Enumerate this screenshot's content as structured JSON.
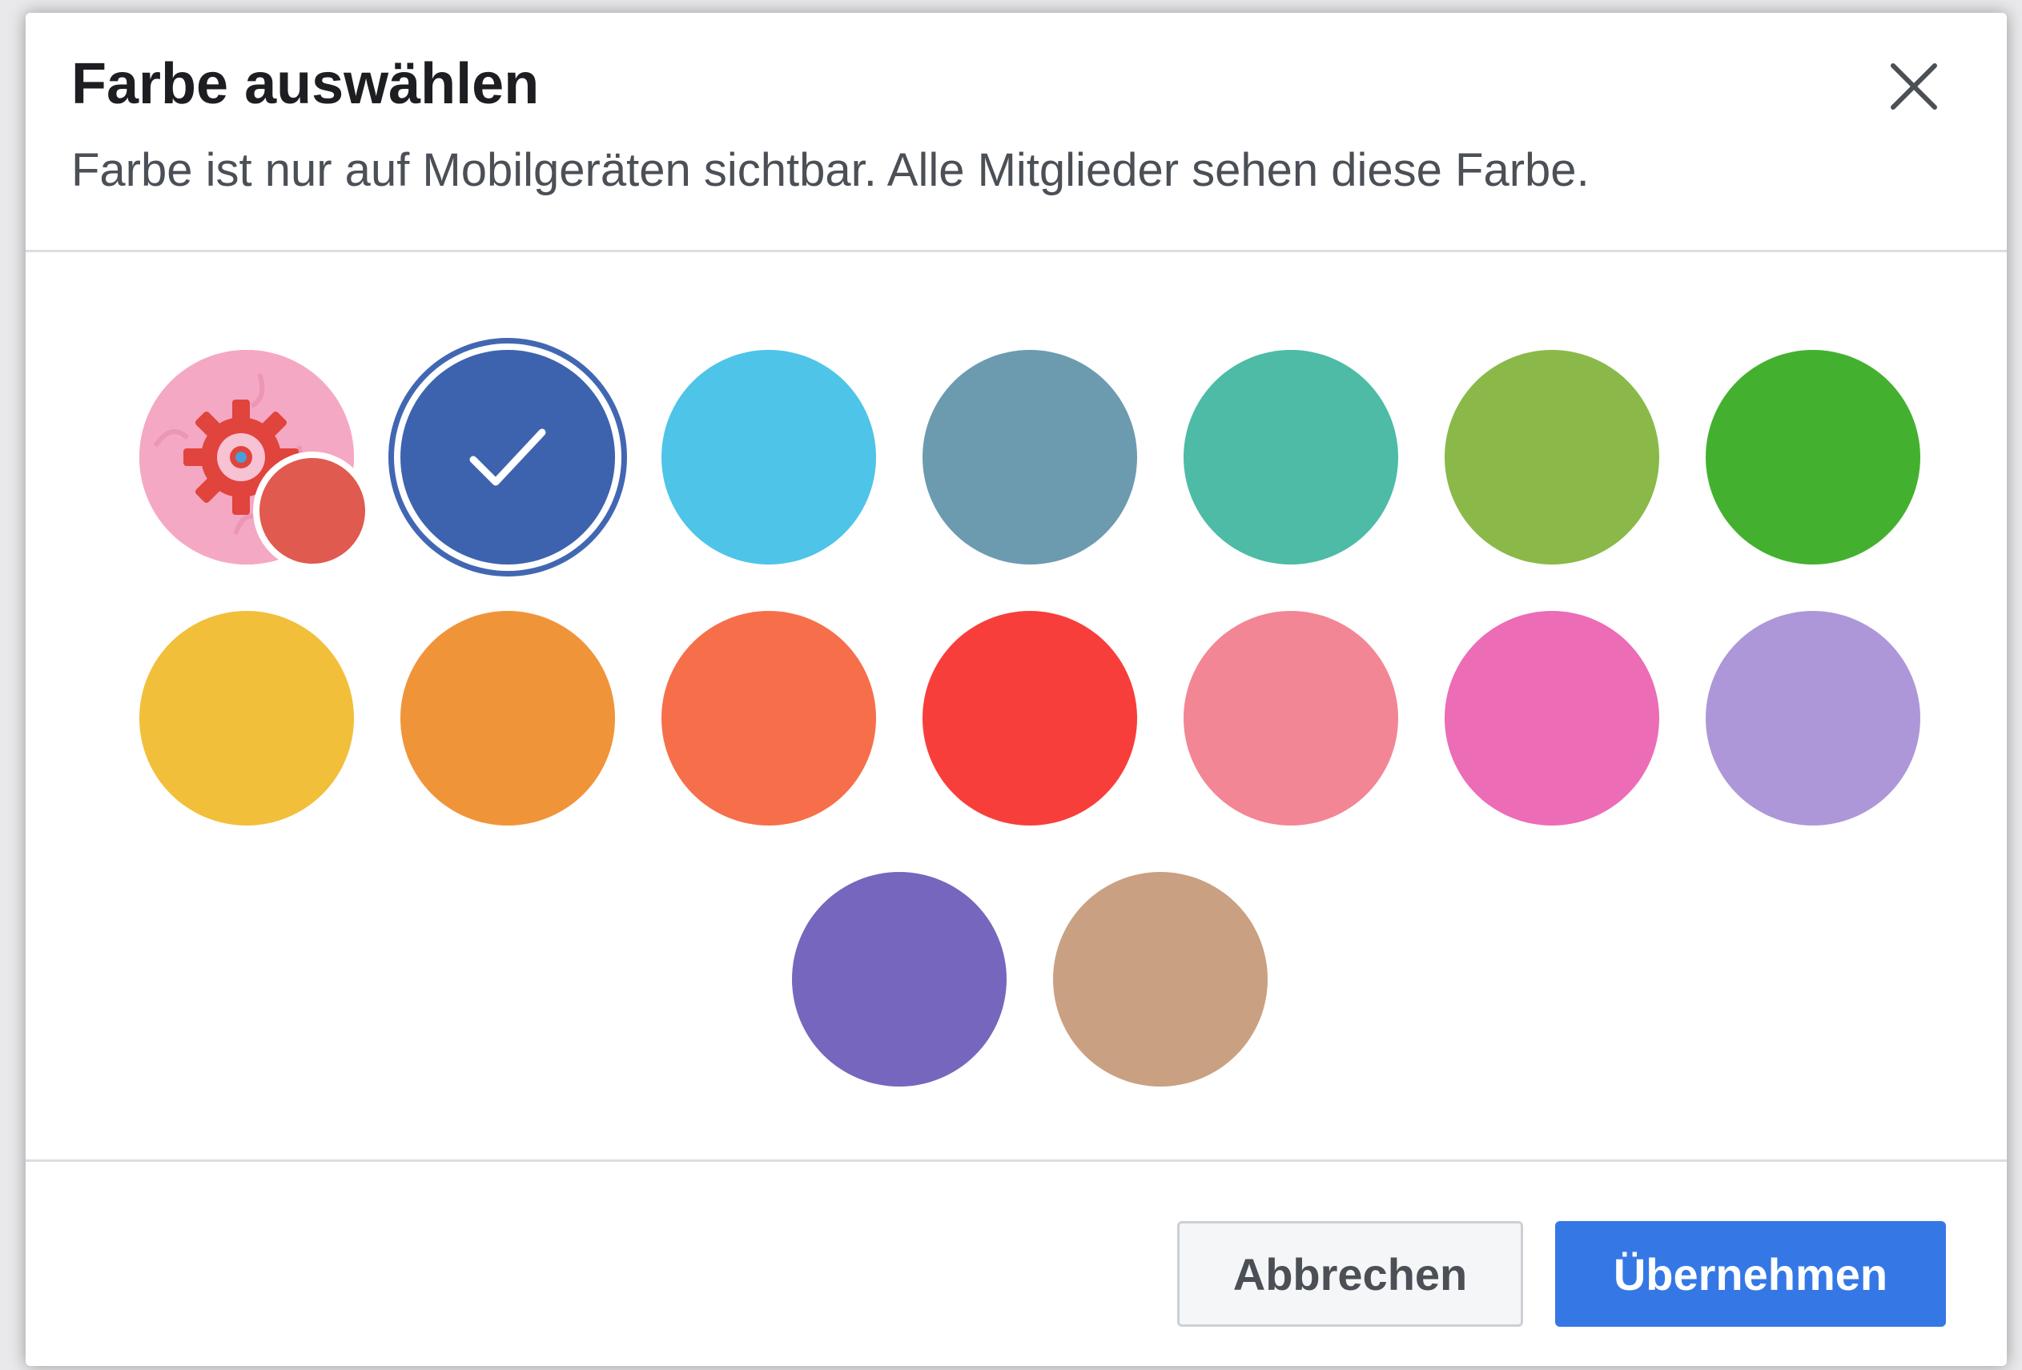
{
  "dialog": {
    "title": "Farbe auswählen",
    "subtitle": "Farbe ist nur auf Mobilgeräten sichtbar. Alle Mitglieder sehen diese Farbe.",
    "close_icon": "close-icon"
  },
  "swatches": [
    {
      "name": "theme-default",
      "color": "#f5a8c3",
      "accent": "#e05a4f",
      "icon": "gear-icon"
    },
    {
      "name": "blue",
      "color": "#3d63ae",
      "selected": true,
      "icon": "check-icon"
    },
    {
      "name": "light-blue",
      "color": "#4ec4e8"
    },
    {
      "name": "slate",
      "color": "#6c9bb0"
    },
    {
      "name": "teal",
      "color": "#4dbba6"
    },
    {
      "name": "lime",
      "color": "#8ab94a"
    },
    {
      "name": "green",
      "color": "#43b12f"
    },
    {
      "name": "yellow",
      "color": "#f2bf3a"
    },
    {
      "name": "orange",
      "color": "#f0943a"
    },
    {
      "name": "coral",
      "color": "#f66f4a"
    },
    {
      "name": "red",
      "color": "#f83e3b"
    },
    {
      "name": "pink",
      "color": "#f38694"
    },
    {
      "name": "magenta",
      "color": "#ec6cb6"
    },
    {
      "name": "lavender",
      "color": "#ad97d8"
    },
    {
      "name": "purple",
      "color": "#7766bd"
    },
    {
      "name": "tan",
      "color": "#c9a182"
    }
  ],
  "footer": {
    "cancel_label": "Abbrechen",
    "apply_label": "Übernehmen"
  },
  "colors": {
    "primary_button": "#3578e5",
    "selected_ring": "#4267b2"
  }
}
